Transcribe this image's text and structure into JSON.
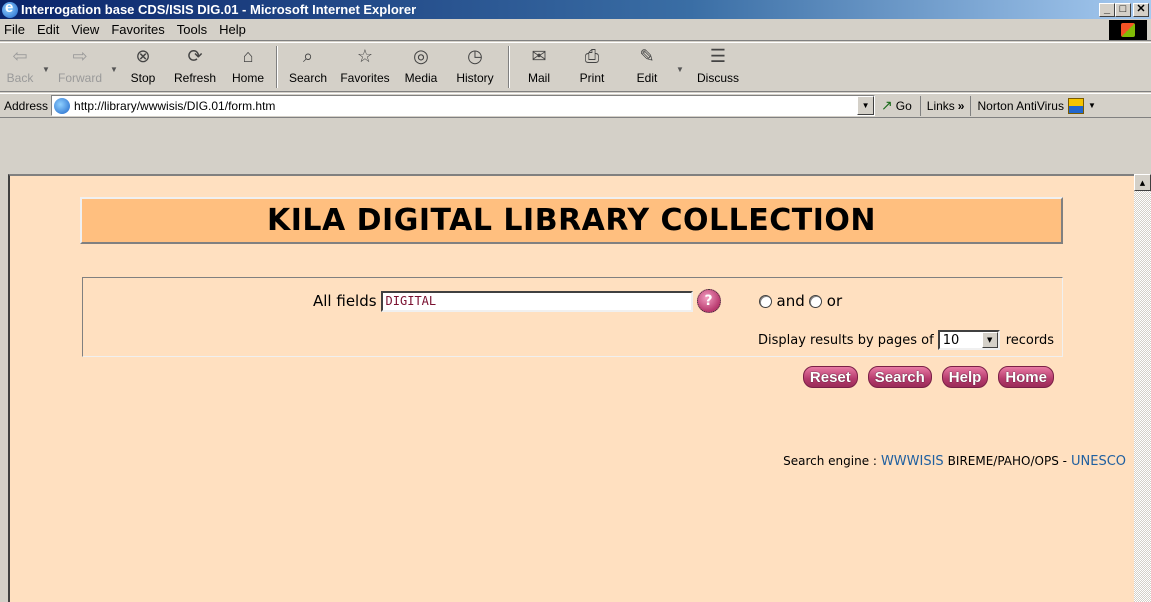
{
  "window": {
    "title": "Interrogation base CDS/ISIS DIG.01 - Microsoft Internet Explorer",
    "min": "_",
    "max": "□",
    "close": "✕"
  },
  "menu": [
    "File",
    "Edit",
    "View",
    "Favorites",
    "Tools",
    "Help"
  ],
  "toolbar": {
    "back": "Back",
    "forward": "Forward",
    "stop": "Stop",
    "refresh": "Refresh",
    "home": "Home",
    "search": "Search",
    "favorites": "Favorites",
    "media": "Media",
    "history": "History",
    "mail": "Mail",
    "print": "Print",
    "edit": "Edit",
    "discuss": "Discuss"
  },
  "address": {
    "label": "Address",
    "url": "http://library/wwwisis/DIG.01/form.htm",
    "go": "Go",
    "links": "Links",
    "links_chevron": "»",
    "norton": "Norton AntiVirus"
  },
  "page": {
    "heading": "KILA DIGITAL LIBRARY COLLECTION",
    "field_label": "All fields",
    "field_value": "DIGITAL",
    "help_symbol": "?",
    "radio_and": "and",
    "radio_or": "or",
    "display_prefix": "Display results by pages of",
    "display_value": "10",
    "display_suffix": "records",
    "buttons": {
      "reset": "Reset",
      "search": "Search",
      "help": "Help",
      "home": "Home"
    },
    "footer": {
      "prefix": "Search engine :",
      "wwwisis": "WWWISIS",
      "middle": "BIREME/PAHO/OPS -",
      "unesco": "UNESCO"
    }
  },
  "colors": {
    "page_bg": "#ffe0c0",
    "header_bg": "#ffbf7f",
    "button": "#b53a6c",
    "link": "#2060a0"
  }
}
